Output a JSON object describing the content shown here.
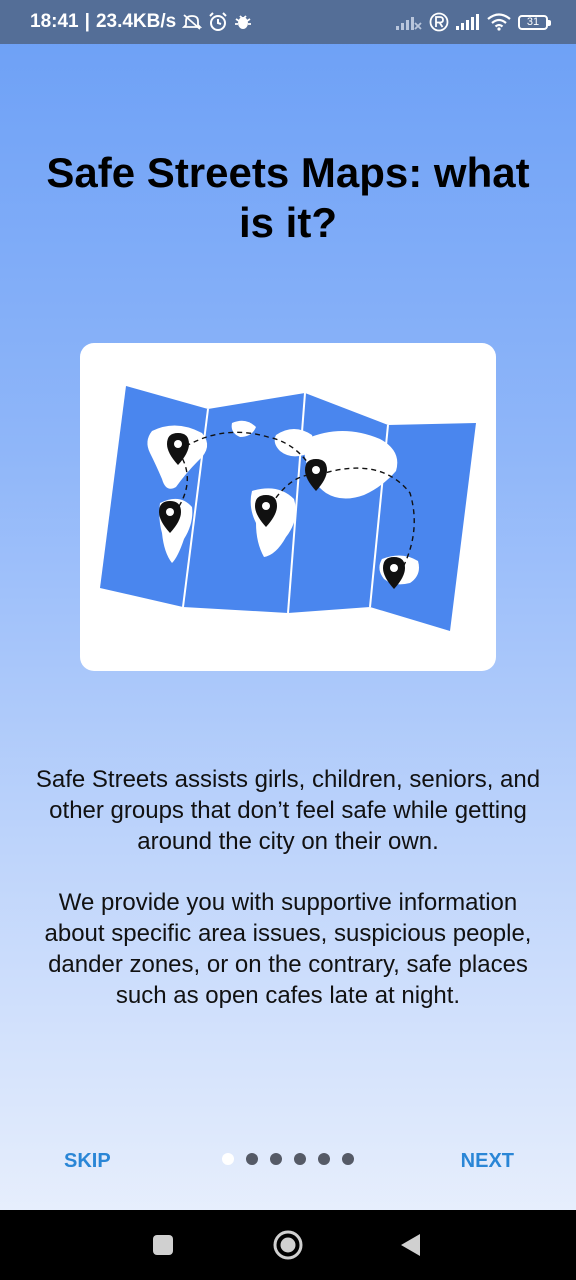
{
  "status_bar": {
    "time": "18:41",
    "network_speed": "23.4KB/s",
    "battery_level": "31",
    "icons": [
      "mute-icon",
      "alarm-icon",
      "bug-icon",
      "signal-icon",
      "roaming-icon",
      "wifi-icon",
      "battery-icon"
    ]
  },
  "onboarding": {
    "title": "Safe Streets Maps: what is it?",
    "paragraph_1": "Safe Streets assists girls, children, seniors, and other groups that don’t feel safe while getting around the city on their own.",
    "paragraph_2": "We provide you with supportive information about specific area issues, suspicious people, dander zones, or on the contrary, safe places such as open cafes late at night.",
    "skip_label": "SKIP",
    "next_label": "NEXT",
    "page_count": 6,
    "current_page": 1
  },
  "colors": {
    "accent": "#2a86d6",
    "map_blue": "#4a86ee",
    "status_bar": "#546e97"
  },
  "nav_bar": {
    "icons": [
      "recents-icon",
      "home-icon",
      "back-icon"
    ]
  }
}
